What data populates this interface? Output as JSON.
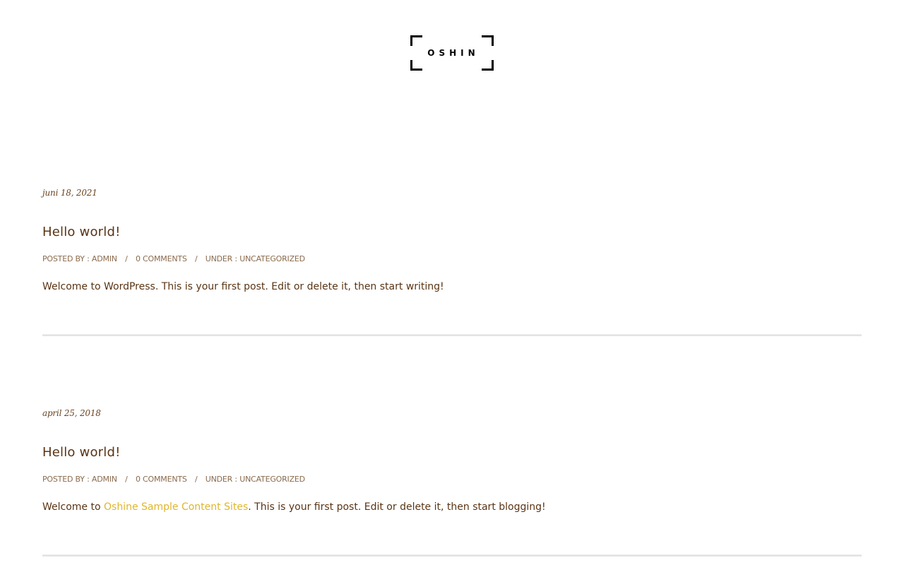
{
  "site": {
    "logo_text": "OSHIN"
  },
  "posts": [
    {
      "date": "juni 18, 2021",
      "title": "Hello world!",
      "meta": {
        "posted_by_label": "POSTED BY :",
        "author": "ADMIN",
        "comments": "0 COMMENTS",
        "under_label": "UNDER :",
        "category": "UNCATEGORIZED",
        "separator": "/"
      },
      "excerpt": "Welcome to WordPress. This is your first post. Edit or delete it, then start writing!"
    },
    {
      "date": "april 25, 2018",
      "title": "Hello world!",
      "meta": {
        "posted_by_label": "POSTED BY :",
        "author": "ADMIN",
        "comments": "0 COMMENTS",
        "under_label": "UNDER :",
        "category": "UNCATEGORIZED",
        "separator": "/"
      },
      "excerpt_prefix": "Welcome to ",
      "excerpt_link": "Oshine Sample Content Sites",
      "excerpt_suffix": ". This is your first post. Edit or delete it, then start blogging!"
    }
  ],
  "colors": {
    "text_brown": "#5a3414",
    "meta_brown": "#8a6a4c",
    "link_gold": "#e0b52a",
    "logo_black": "#000000",
    "divider_gray": "#e3e3e3"
  }
}
